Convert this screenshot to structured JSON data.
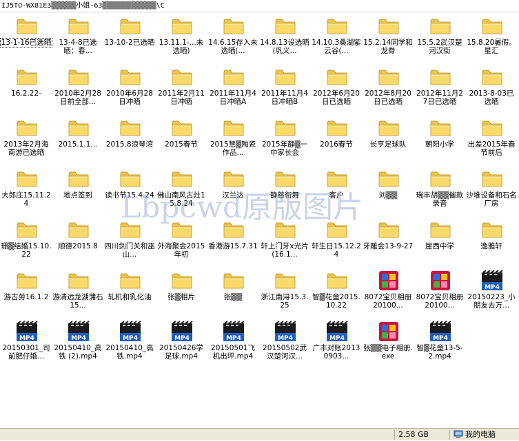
{
  "address_bar": {
    "path": "IJ5TO-WX81E3▒▒▒▒▒▒小姐-63▒▒▒▒▒▒▒▒▒▒▒▒▒\\C"
  },
  "status": {
    "size": "2.58 GB",
    "location": "我的电脑"
  },
  "watermark": "Lbpcwd原版图片",
  "items": [
    {
      "label": "13-1-16已选晒",
      "type": "folder"
    },
    {
      "label": "13-4-8已选晒：春...",
      "type": "folder"
    },
    {
      "label": "13-10-2已选晒",
      "type": "folder"
    },
    {
      "label": "13.11.1-...未选晒)",
      "type": "folder"
    },
    {
      "label": "14.6.15存入未选晒(...",
      "type": "folder"
    },
    {
      "label": "14.8.13设选晒(巩义...",
      "type": "folder"
    },
    {
      "label": "14.10.3桑湖紫云谷(...",
      "type": "folder"
    },
    {
      "label": "15.2.14同学和龙脊",
      "type": "folder"
    },
    {
      "label": "15.5.2武汉楚河汉街",
      "type": "folder"
    },
    {
      "label": "15.8.20暑假。星汇",
      "type": "folder"
    },
    {
      "label": "16.2.22-",
      "type": "folder"
    },
    {
      "label": "2010年2月28日前全部...",
      "type": "folder"
    },
    {
      "label": "2010年6月28日冲晒",
      "type": "folder"
    },
    {
      "label": "2011年2月11日冲晒",
      "type": "folder"
    },
    {
      "label": "2011年11月4日冲晒A",
      "type": "folder"
    },
    {
      "label": "2011年11月4日冲晒B",
      "type": "folder"
    },
    {
      "label": "2012年6月20日已选晒",
      "type": "folder"
    },
    {
      "label": "2012年8月20日已选晒",
      "type": "folder"
    },
    {
      "label": "2012年11月27日已选晒",
      "type": "folder"
    },
    {
      "label": "2013-8-03已选晒",
      "type": "folder"
    },
    {
      "label": "2013年2月海南游已选晒",
      "type": "folder"
    },
    {
      "label": "2015.1.1...",
      "type": "folder"
    },
    {
      "label": "2015.8浪琴湾",
      "type": "folder"
    },
    {
      "label": "2015春节",
      "type": "folder"
    },
    {
      "label": "2015慧▒陶瓷作品...",
      "type": "folder"
    },
    {
      "label": "2015年静▒一中家长会",
      "type": "folder"
    },
    {
      "label": "2016春节",
      "type": "folder"
    },
    {
      "label": "长亨足球队",
      "type": "folder"
    },
    {
      "label": "朝阳小学",
      "type": "folder"
    },
    {
      "label": "出差2015年春节前后",
      "type": "folder"
    },
    {
      "label": "大郎庄15.11.24",
      "type": "folder"
    },
    {
      "label": "地点签到",
      "type": "folder"
    },
    {
      "label": "读书节15.4.24",
      "type": "folder"
    },
    {
      "label": "佛山南风古灶15.8.24",
      "type": "folder"
    },
    {
      "label": "汉兰达",
      "type": "folder"
    },
    {
      "label": "静慈衔舞",
      "type": "folder"
    },
    {
      "label": "客户",
      "type": "folder"
    },
    {
      "label": "刘▒▒",
      "type": "folder"
    },
    {
      "label": "瑞丰胡▒▒催款录音",
      "type": "folder"
    },
    {
      "label": "沙堆设备和石名厂房",
      "type": "folder"
    },
    {
      "label": "珊▒结婚15.10.22",
      "type": "folder"
    },
    {
      "label": "顺德2015.8",
      "type": "folder"
    },
    {
      "label": "四川剑门关和巫山...",
      "type": "folder"
    },
    {
      "label": "外海聚会2015年初",
      "type": "folder"
    },
    {
      "label": "香港游15.7.31",
      "type": "folder"
    },
    {
      "label": "轩上门牙x光片(16.1...",
      "type": "folder"
    },
    {
      "label": "轩生日15.12.24",
      "type": "folder"
    },
    {
      "label": "牙雕会13-9-27",
      "type": "folder"
    },
    {
      "label": "崖西中学",
      "type": "folder"
    },
    {
      "label": "逸雅轩",
      "type": "folder"
    },
    {
      "label": "游古劳16.1.2",
      "type": "folder"
    },
    {
      "label": "游清远龙湖蒲石15...",
      "type": "folder"
    },
    {
      "label": "轧机和乳化油",
      "type": "folder"
    },
    {
      "label": "张▒相片",
      "type": "folder"
    },
    {
      "label": "张▒▒",
      "type": "folder"
    },
    {
      "label": "浙江南浔15.3.25",
      "type": "folder"
    },
    {
      "label": "智▒花童2015.10.22",
      "type": "folder"
    },
    {
      "label": "8072宝贝相册20100...",
      "type": "app"
    },
    {
      "label": "8072宝贝相册20100...",
      "type": "app"
    },
    {
      "label": "20150223_小朋友去万...",
      "type": "mp4"
    },
    {
      "label": "20150301_司前肥仔婚...",
      "type": "mp4"
    },
    {
      "label": "20150410_高铁 (2).mp4",
      "type": "mp4"
    },
    {
      "label": "20150410_高铁.mp4",
      "type": "mp4"
    },
    {
      "label": "20150426学足球.mp4",
      "type": "mp4"
    },
    {
      "label": "20150501飞机出坪.mp4",
      "type": "mp4"
    },
    {
      "label": "20150502武汉楚河汉...",
      "type": "mp4"
    },
    {
      "label": "广丰对账20130903...",
      "type": "mp4"
    },
    {
      "label": "张▒▒电子相册.exe",
      "type": "app"
    },
    {
      "label": "智▒花童13-5-2.mp4",
      "type": "mp4"
    }
  ]
}
